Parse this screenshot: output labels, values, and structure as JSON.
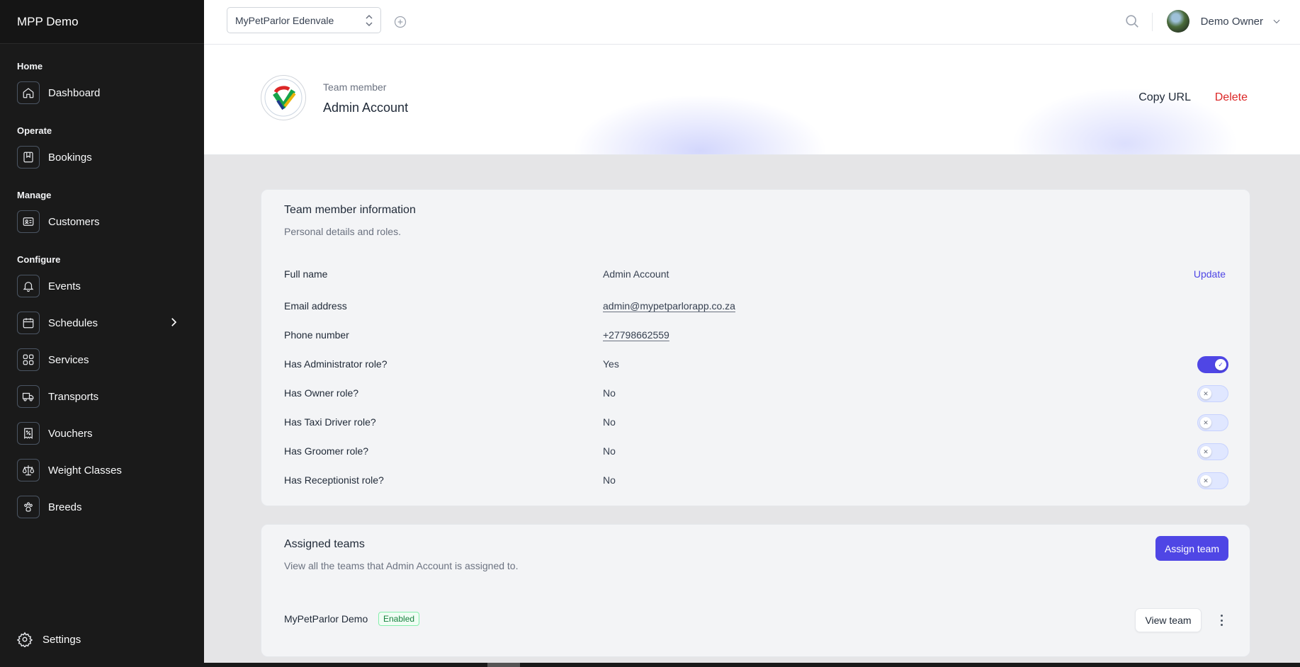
{
  "app": {
    "title": "MPP Demo"
  },
  "sidebar": {
    "sections": {
      "home": "Home",
      "operate": "Operate",
      "manage": "Manage",
      "configure": "Configure"
    },
    "items": {
      "dashboard": "Dashboard",
      "bookings": "Bookings",
      "customers": "Customers",
      "events": "Events",
      "schedules": "Schedules",
      "services": "Services",
      "transports": "Transports",
      "vouchers": "Vouchers",
      "weight_classes": "Weight Classes",
      "breeds": "Breeds"
    },
    "settings": "Settings"
  },
  "topbar": {
    "location": "MyPetParlor Edenvale",
    "user_name": "Demo Owner"
  },
  "header": {
    "subtitle": "Team member",
    "title": "Admin Account",
    "copy_url": "Copy URL",
    "delete": "Delete"
  },
  "info_card": {
    "title": "Team member information",
    "description": "Personal details and roles.",
    "update_label": "Update",
    "rows": [
      {
        "label": "Full name",
        "value": "Admin Account"
      },
      {
        "label": "Email address",
        "value": "admin@mypetparlorapp.co.za"
      },
      {
        "label": "Phone number",
        "value": "+27798662559"
      },
      {
        "label": "Has Administrator role?",
        "value": "Yes",
        "enabled": true
      },
      {
        "label": "Has Owner role?",
        "value": "No",
        "enabled": false
      },
      {
        "label": "Has Taxi Driver role?",
        "value": "No",
        "enabled": false
      },
      {
        "label": "Has Groomer role?",
        "value": "No",
        "enabled": false
      },
      {
        "label": "Has Receptionist role?",
        "value": "No",
        "enabled": false
      }
    ]
  },
  "teams_card": {
    "title": "Assigned teams",
    "description": "View all the teams that Admin Account is assigned to.",
    "assign_label": "Assign team",
    "teams": [
      {
        "name": "MyPetParlor Demo",
        "status": "Enabled",
        "action": "View team"
      }
    ]
  },
  "colors": {
    "accent": "#4f46e5",
    "danger": "#dc2626",
    "sidebar": "#1a1a1a",
    "success": "#15803d"
  }
}
